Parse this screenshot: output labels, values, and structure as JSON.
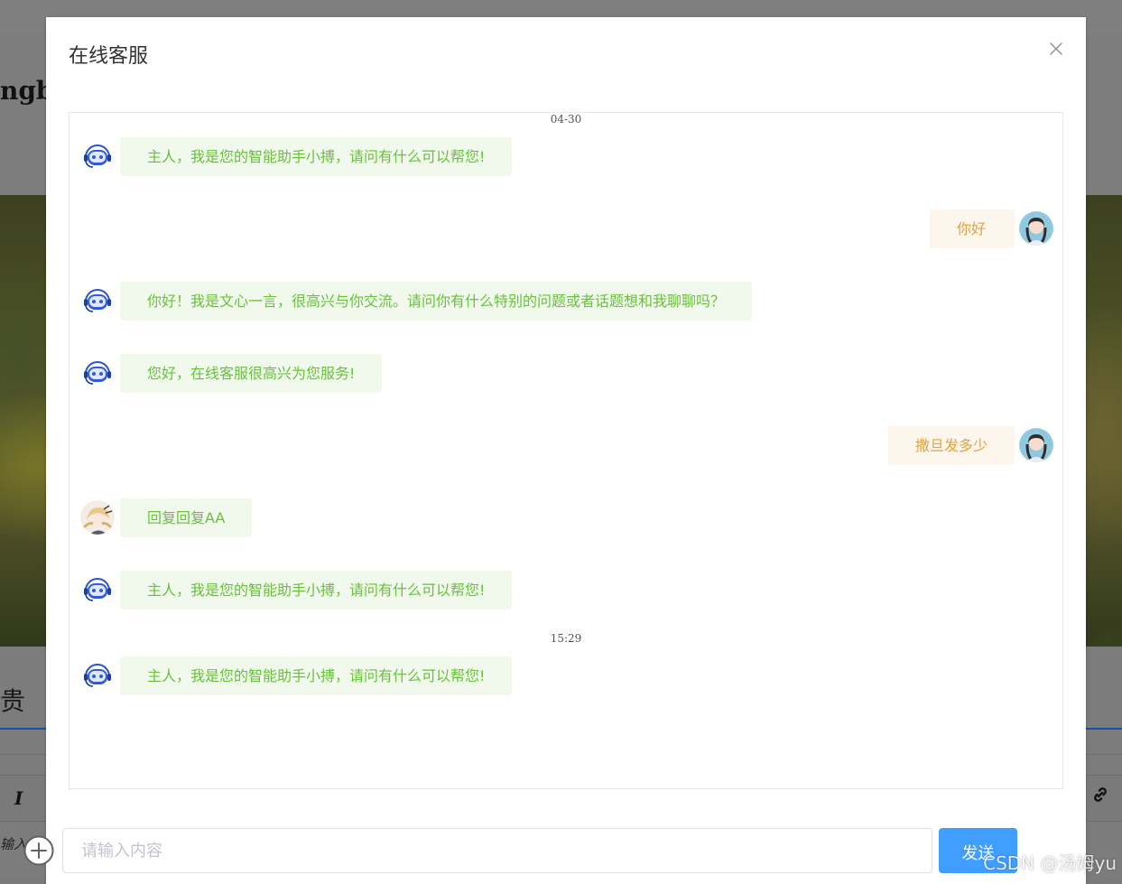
{
  "background": {
    "brand_fragment": "ngb",
    "section_fragment": "贵",
    "editor_placeholder_fragment": "输入正文",
    "toolbar_italic": "I",
    "toolbar_link_icon": "link-icon"
  },
  "dialog": {
    "title": "在线客服",
    "close_icon": "close-icon"
  },
  "chat": {
    "timestamps": [
      "04-30",
      "15:29"
    ],
    "messages": [
      {
        "side": "left",
        "avatar": "robot-avatar",
        "text": "主人，我是您的智能助手小搏，请问有什么可以帮您!"
      },
      {
        "side": "right",
        "avatar": "user-avatar",
        "text": "你好"
      },
      {
        "side": "left",
        "avatar": "robot-avatar",
        "text": "你好！我是文心一言，很高兴与你交流。请问你有什么特别的问题或者话题想和我聊聊吗？"
      },
      {
        "side": "left",
        "avatar": "robot-avatar",
        "text": "您好，在线客服很高兴为您服务!"
      },
      {
        "side": "right",
        "avatar": "user-avatar",
        "text": "撒旦发多少"
      },
      {
        "side": "left",
        "avatar": "agent-avatar",
        "text": "回复回复AA"
      },
      {
        "side": "left",
        "avatar": "robot-avatar",
        "text": "主人，我是您的智能助手小搏，请问有什么可以帮您!"
      },
      {
        "side": "left",
        "avatar": "robot-avatar",
        "text": "主人，我是您的智能助手小搏，请问有什么可以帮您!"
      }
    ]
  },
  "footer": {
    "add_icon": "plus-circle-icon",
    "input_placeholder": "请输入内容",
    "input_value": "",
    "send_label": "发送"
  },
  "watermark": "CSDN @汤姆yu",
  "colors": {
    "left_bubble_bg": "#f0f9eb",
    "left_bubble_text": "#67c23a",
    "right_bubble_bg": "#fdf6ec",
    "right_bubble_text": "#e6a23c",
    "send_button": "#409eff"
  }
}
